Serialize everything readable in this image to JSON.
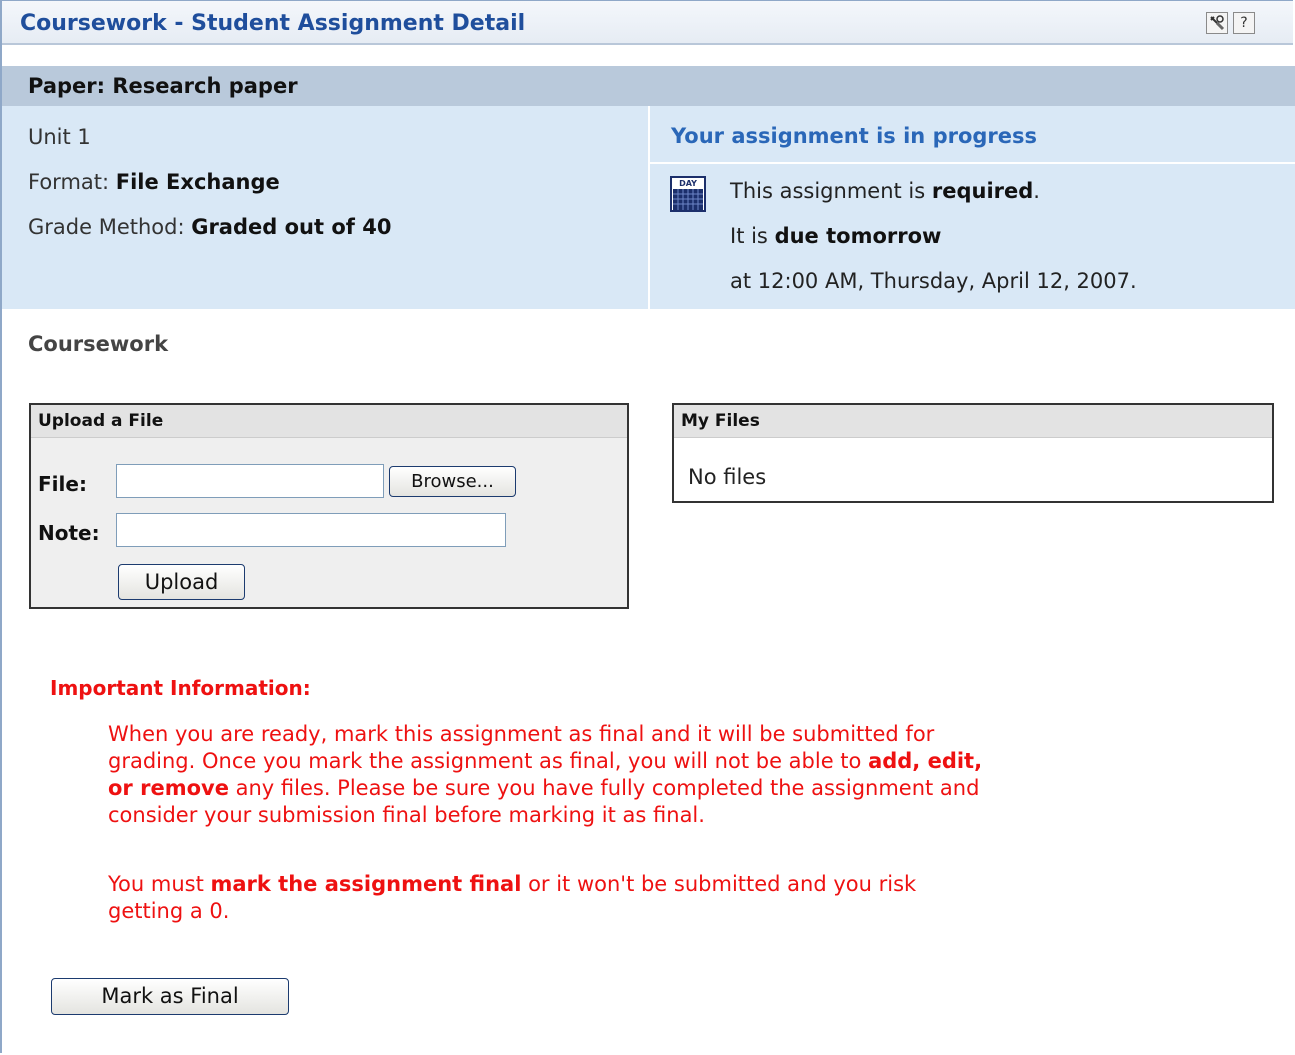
{
  "window": {
    "title": "Coursework - Student Assignment Detail",
    "tools_icon": "tools-icon",
    "help_label": "?"
  },
  "paper": {
    "heading": "Paper: Research paper",
    "unit": "Unit 1",
    "format_label": "Format: ",
    "format_value": "File Exchange",
    "grade_label": "Grade Method: ",
    "grade_value": "Graded out of 40"
  },
  "status": {
    "title": "Your assignment is in progress",
    "line1_pre": "This assignment is ",
    "line1_bold": "required",
    "line1_post": ".",
    "line2_pre": "It is ",
    "line2_bold": "due tomorrow",
    "line3": "at 12:00 AM, Thursday, April 12, 2007.",
    "calendar_label": "DAY"
  },
  "coursework": {
    "section_title": "Coursework",
    "upload": {
      "heading": "Upload a File",
      "file_label": "File:",
      "file_value": "",
      "browse_label": "Browse...",
      "note_label": "Note:",
      "note_value": "",
      "upload_label": "Upload"
    },
    "myfiles": {
      "heading": "My Files",
      "empty_text": "No files"
    }
  },
  "important": {
    "title": "Important Information:",
    "p1_a": "When you are ready, mark this assignment as final and it will be submitted for grading. Once you mark the assignment as final, you will not be able to ",
    "p1_b": "add, edit, or remove",
    "p1_c": " any files. Please be sure you have fully completed the assignment and consider your submission final before marking it as final.",
    "p2_a": "You must ",
    "p2_b": "mark the assignment final",
    "p2_c": " or it won't be submitted and you risk getting a 0."
  },
  "actions": {
    "mark_final_label": "Mark as Final"
  },
  "colors": {
    "title_blue": "#1f4e9c",
    "info_bg": "#d9e8f6",
    "paper_bar": "#b9c9db",
    "warning_red": "#ee1111"
  }
}
